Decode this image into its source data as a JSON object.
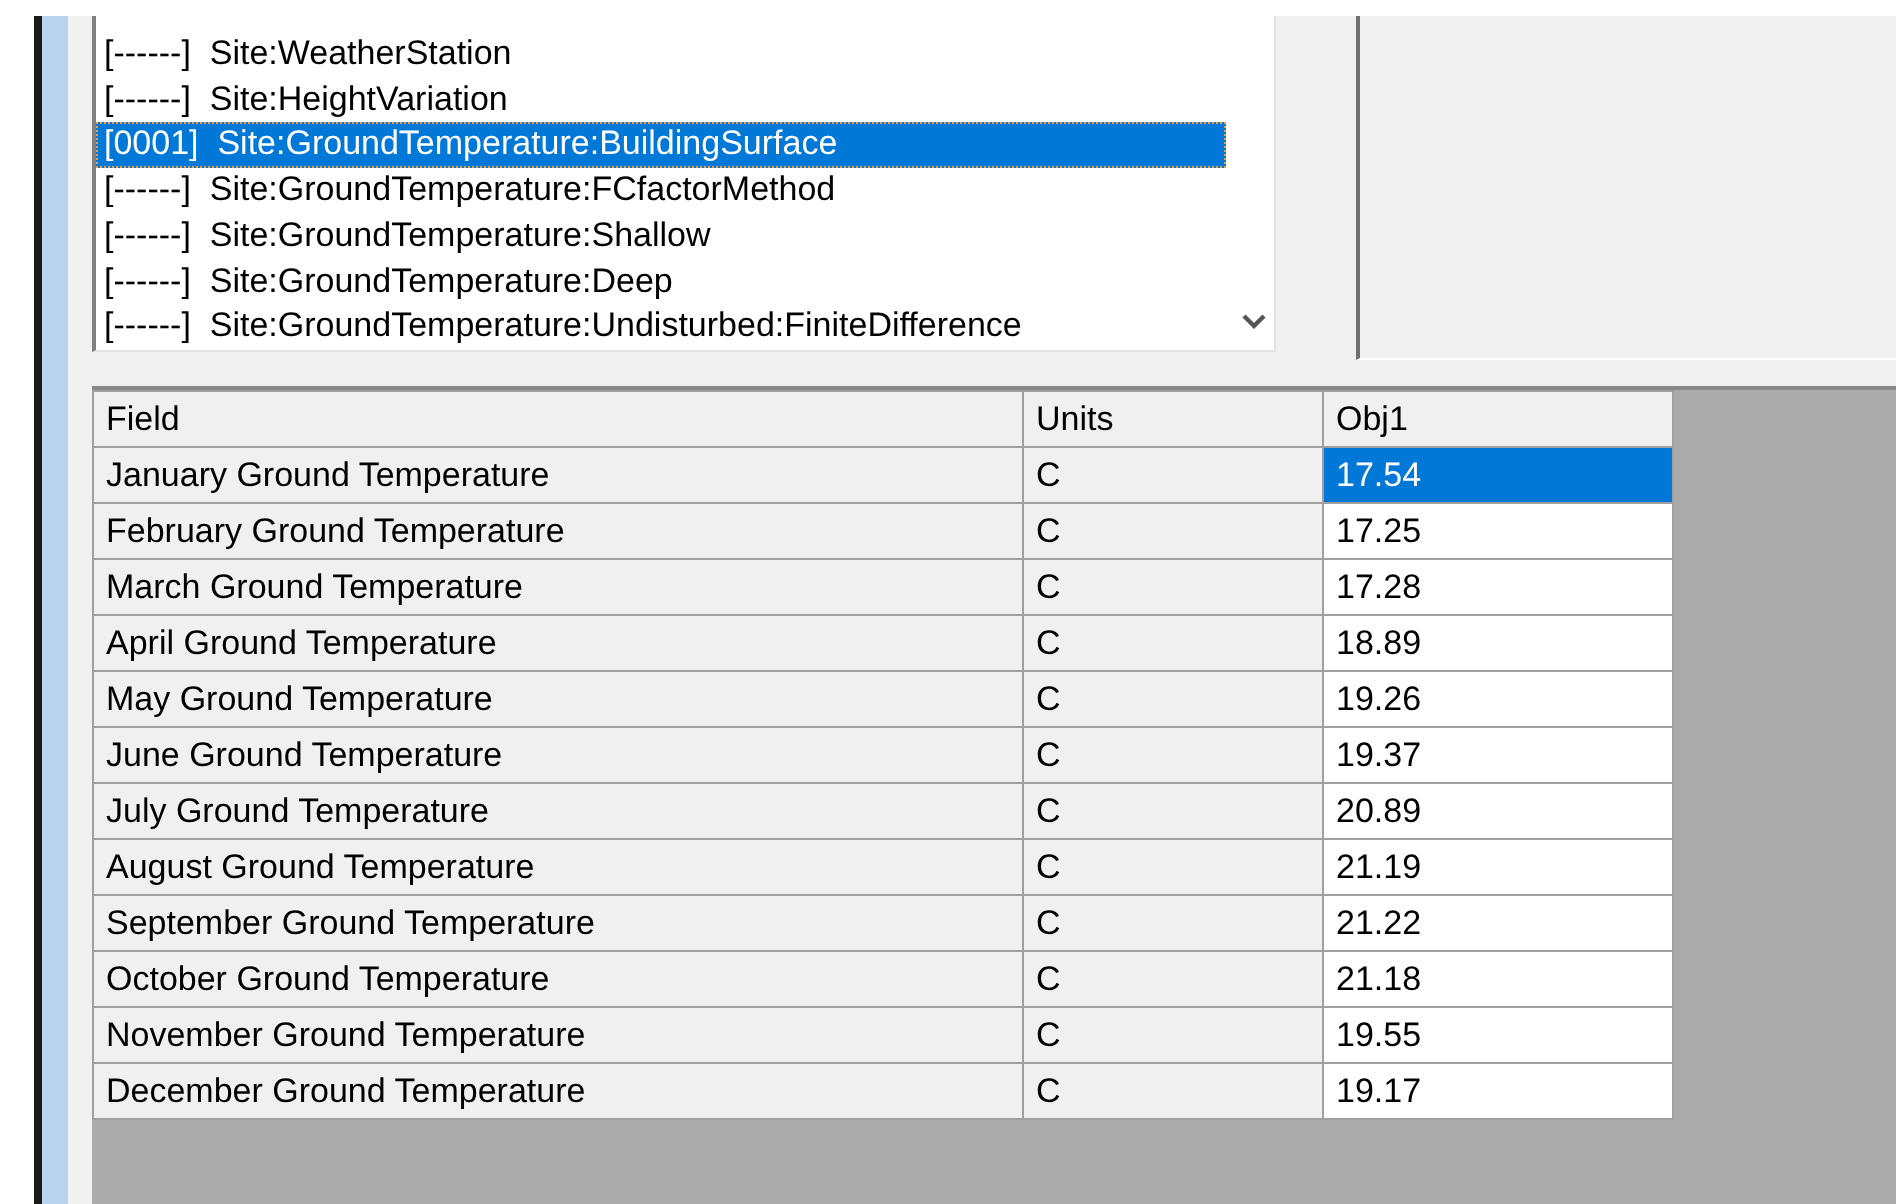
{
  "class_list": {
    "items": [
      {
        "count": "[------]",
        "name": "Site:WeatherStation",
        "selected": false
      },
      {
        "count": "[------]",
        "name": "Site:HeightVariation",
        "selected": false
      },
      {
        "count": "[0001]",
        "name": "Site:GroundTemperature:BuildingSurface",
        "selected": true
      },
      {
        "count": "[------]",
        "name": "Site:GroundTemperature:FCfactorMethod",
        "selected": false
      },
      {
        "count": "[------]",
        "name": "Site:GroundTemperature:Shallow",
        "selected": false
      },
      {
        "count": "[------]",
        "name": "Site:GroundTemperature:Deep",
        "selected": false
      },
      {
        "count": "[------]",
        "name": "Site:GroundTemperature:Undisturbed:FiniteDifference",
        "selected": false
      }
    ]
  },
  "grid": {
    "columns": [
      "Field",
      "Units",
      "Obj1"
    ],
    "rows": [
      {
        "field": "January Ground Temperature",
        "units": "C",
        "value": "17.54",
        "selected": true
      },
      {
        "field": "February Ground Temperature",
        "units": "C",
        "value": "17.25",
        "selected": false
      },
      {
        "field": "March Ground Temperature",
        "units": "C",
        "value": "17.28",
        "selected": false
      },
      {
        "field": "April Ground Temperature",
        "units": "C",
        "value": "18.89",
        "selected": false
      },
      {
        "field": "May Ground Temperature",
        "units": "C",
        "value": "19.26",
        "selected": false
      },
      {
        "field": "June Ground Temperature",
        "units": "C",
        "value": "19.37",
        "selected": false
      },
      {
        "field": "July Ground Temperature",
        "units": "C",
        "value": "20.89",
        "selected": false
      },
      {
        "field": "August Ground Temperature",
        "units": "C",
        "value": "21.19",
        "selected": false
      },
      {
        "field": "September Ground Temperature",
        "units": "C",
        "value": "21.22",
        "selected": false
      },
      {
        "field": "October Ground Temperature",
        "units": "C",
        "value": "21.18",
        "selected": false
      },
      {
        "field": "November Ground Temperature",
        "units": "C",
        "value": "19.55",
        "selected": false
      },
      {
        "field": "December Ground Temperature",
        "units": "C",
        "value": "19.17",
        "selected": false
      }
    ]
  }
}
